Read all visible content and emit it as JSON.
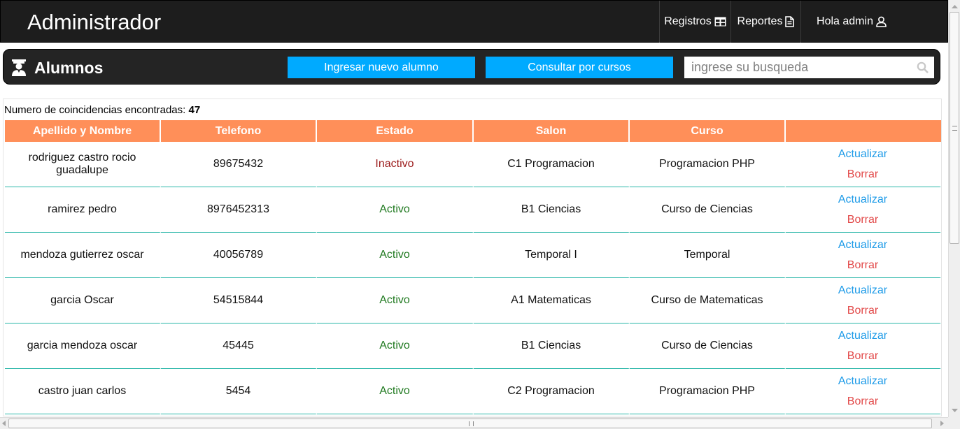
{
  "header": {
    "brand": "Administrador",
    "nav": [
      {
        "label": "Registros",
        "icon": "table-icon"
      },
      {
        "label": "Reportes",
        "icon": "document-icon"
      },
      {
        "label": "Hola admin",
        "icon": "user-icon"
      }
    ]
  },
  "section": {
    "title": "Alumnos",
    "icon": "student-icon",
    "new_button": "Ingresar nuevo alumno",
    "courses_button": "Consultar por cursos",
    "search_placeholder": "ingrese su busqueda"
  },
  "results": {
    "label": "Numero de coincidencias encontradas:",
    "count": "47"
  },
  "table": {
    "headers": [
      "Apellido y Nombre",
      "Telefono",
      "Estado",
      "Salon",
      "Curso",
      ""
    ],
    "update_label": "Actualizar",
    "delete_label": "Borrar",
    "rows": [
      {
        "nombre": "rodriguez castro rocio guadalupe",
        "telefono": "89675432",
        "estado": "Inactivo",
        "salon": "C1 Programacion",
        "curso": "Programacion PHP"
      },
      {
        "nombre": "ramirez pedro",
        "telefono": "8976452313",
        "estado": "Activo",
        "salon": "B1 Ciencias",
        "curso": "Curso de Ciencias"
      },
      {
        "nombre": "mendoza gutierrez oscar",
        "telefono": "40056789",
        "estado": "Activo",
        "salon": "Temporal I",
        "curso": "Temporal"
      },
      {
        "nombre": "garcia Oscar",
        "telefono": "54515844",
        "estado": "Activo",
        "salon": "A1 Matematicas",
        "curso": "Curso de Matematicas"
      },
      {
        "nombre": "garcia mendoza oscar",
        "telefono": "45445",
        "estado": "Activo",
        "salon": "B1 Ciencias",
        "curso": "Curso de Ciencias"
      },
      {
        "nombre": "castro juan carlos",
        "telefono": "5454",
        "estado": "Activo",
        "salon": "C2 Programacion",
        "curso": "Programacion PHP"
      }
    ]
  },
  "colors": {
    "header_bg": "#1d1d1d",
    "button_blue": "#00aaff",
    "table_header": "#ff8f59",
    "row_divider": "#29b6a8",
    "inactive": "#9b1b1b",
    "active": "#217a21",
    "link_update": "#1e9be8",
    "link_delete": "#e24a4a"
  }
}
